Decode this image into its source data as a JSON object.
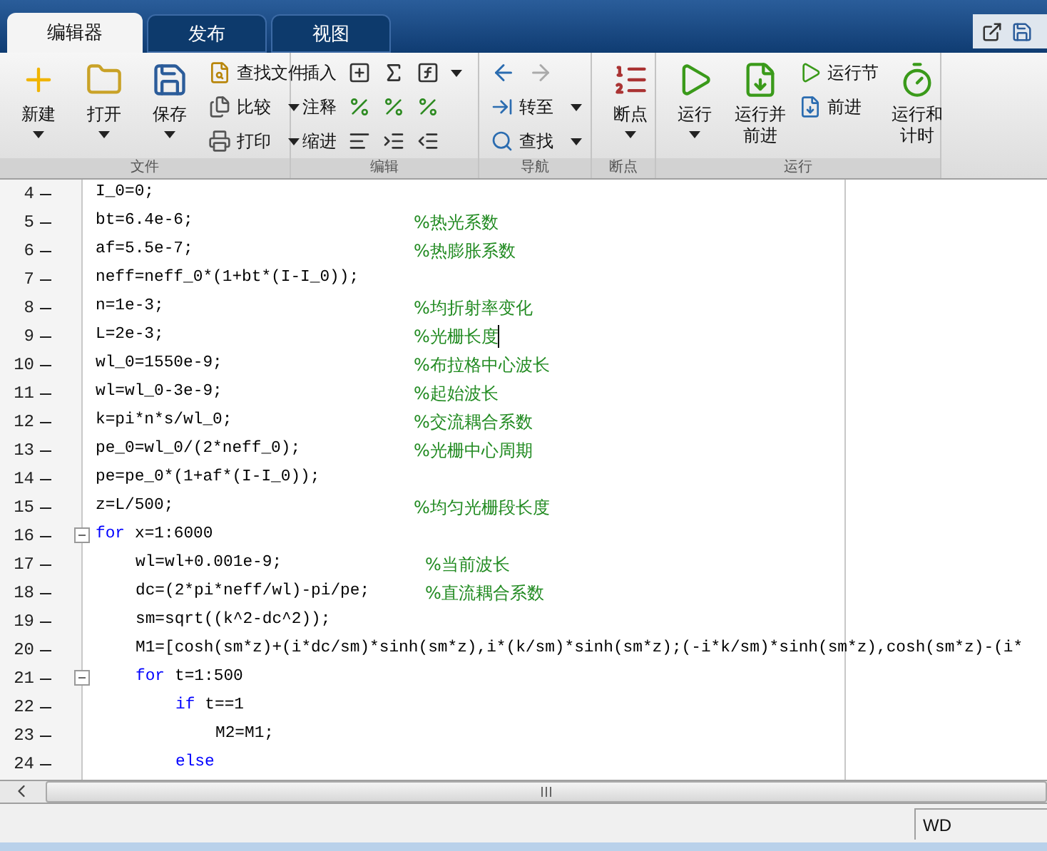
{
  "tabs": [
    {
      "label": "编辑器",
      "selected": true
    },
    {
      "label": "发布",
      "selected": false
    },
    {
      "label": "视图",
      "selected": false
    }
  ],
  "ribbon": [
    {
      "label": "文件",
      "columns": [
        {
          "kind": "large",
          "label": "新建",
          "caret": true
        },
        {
          "kind": "large",
          "label": "打开",
          "caret": true
        },
        {
          "kind": "large",
          "label": "保存",
          "caret": true
        },
        {
          "kind": "stack",
          "items": [
            {
              "kind": "small",
              "label": "查找文件",
              "caret": false
            },
            {
              "kind": "small",
              "label": "比较",
              "caret": true
            },
            {
              "kind": "small",
              "label": "打印",
              "caret": true
            }
          ]
        }
      ]
    },
    {
      "label": "编辑",
      "columns": [
        {
          "kind": "stack",
          "items": [
            {
              "kind": "row",
              "label": "插入",
              "caret": true
            },
            {
              "kind": "row",
              "label": "注释",
              "caret": false
            },
            {
              "kind": "row",
              "label": "缩进",
              "caret": false
            }
          ]
        }
      ]
    },
    {
      "label": "导航",
      "columns": [
        {
          "kind": "stack",
          "items": [
            {
              "kind": "icons",
              "caret": false
            },
            {
              "kind": "small",
              "label": "转至",
              "caret": true
            },
            {
              "kind": "small",
              "label": "查找",
              "caret": true
            }
          ]
        }
      ]
    },
    {
      "label": "断点",
      "columns": [
        {
          "kind": "large",
          "label": "断点",
          "caret": true
        }
      ]
    },
    {
      "label": "运行",
      "columns": [
        {
          "kind": "large",
          "label": "运行",
          "caret": true
        },
        {
          "kind": "large",
          "label": "运行并前进",
          "caret": false
        },
        {
          "kind": "stack",
          "items": [
            {
              "kind": "small",
              "label": "运行节",
              "caret": false
            },
            {
              "kind": "small",
              "label": "前进",
              "caret": false
            }
          ]
        },
        {
          "kind": "large",
          "label": "运行和计时",
          "caret": false
        }
      ]
    }
  ],
  "editor": {
    "lines": [
      {
        "number": "4",
        "executable": true,
        "cursor": false,
        "code": "I_0=0;"
      },
      {
        "number": "5",
        "executable": true,
        "cursor": false,
        "code": "bt=6.4e-6;",
        "comment": "%热光系数"
      },
      {
        "number": "6",
        "executable": true,
        "cursor": false,
        "code": "af=5.5e-7;",
        "comment": "%热膨胀系数"
      },
      {
        "number": "7",
        "executable": true,
        "cursor": false,
        "code": "neff=neff_0*(1+bt*(I-I_0));"
      },
      {
        "number": "8",
        "executable": true,
        "cursor": false,
        "code": "n=1e-3;",
        "comment": "%均折射率变化"
      },
      {
        "number": "9",
        "executable": true,
        "cursor": true,
        "code": "L=2e-3;",
        "comment": "%光栅长度"
      },
      {
        "number": "10",
        "executable": true,
        "cursor": false,
        "code": "wl_0=1550e-9;",
        "comment": "%布拉格中心波长"
      },
      {
        "number": "11",
        "executable": true,
        "cursor": false,
        "code": "wl=wl_0-3e-9;",
        "comment": "%起始波长"
      },
      {
        "number": "12",
        "executable": true,
        "cursor": false,
        "code": "k=pi*n*s/wl_0;",
        "comment": "%交流耦合系数"
      },
      {
        "number": "13",
        "executable": true,
        "cursor": false,
        "code": "pe_0=wl_0/(2*neff_0);",
        "comment": "%光栅中心周期"
      },
      {
        "number": "14",
        "executable": true,
        "cursor": false,
        "code": "pe=pe_0*(1+af*(I-I_0));"
      },
      {
        "number": "15",
        "executable": true,
        "cursor": false,
        "code": "z=L/500;",
        "comment": "%均匀光栅段长度"
      },
      {
        "number": "16",
        "executable": true,
        "cursor": false,
        "keyword": "for",
        "code": "x=1:6000",
        "expanded": true,
        "children": [
          {
            "number": "17",
            "executable": true,
            "cursor": false,
            "code": "wl=wl+0.001e-9;",
            "comment": "%当前波长"
          },
          {
            "number": "18",
            "executable": true,
            "cursor": false,
            "code": "dc=(2*pi*neff/wl)-pi/pe;",
            "comment": "%直流耦合系数"
          },
          {
            "number": "19",
            "executable": true,
            "cursor": false,
            "code": "sm=sqrt((k^2-dc^2));"
          },
          {
            "number": "20",
            "executable": true,
            "cursor": false,
            "code": "M1=[cosh(sm*z)+(i*dc/sm)*sinh(sm*z),i*(k/sm)*sinh(sm*z);(-i*k/sm)*sinh(sm*z),cosh(sm*z)-(i*"
          },
          {
            "number": "21",
            "executable": true,
            "cursor": false,
            "keyword": "for",
            "code": "t=1:500",
            "expanded": true,
            "children": [
              {
                "number": "22",
                "executable": true,
                "cursor": false,
                "keyword": "if",
                "code": "t==1",
                "children": [
                  {
                    "number": "23",
                    "executable": true,
                    "cursor": false,
                    "code": "M2=M1;"
                  }
                ]
              },
              {
                "number": "24",
                "executable": true,
                "cursor": false,
                "keyword": "else"
              }
            ]
          }
        ]
      }
    ]
  },
  "status_bar": {
    "field": "WD"
  }
}
